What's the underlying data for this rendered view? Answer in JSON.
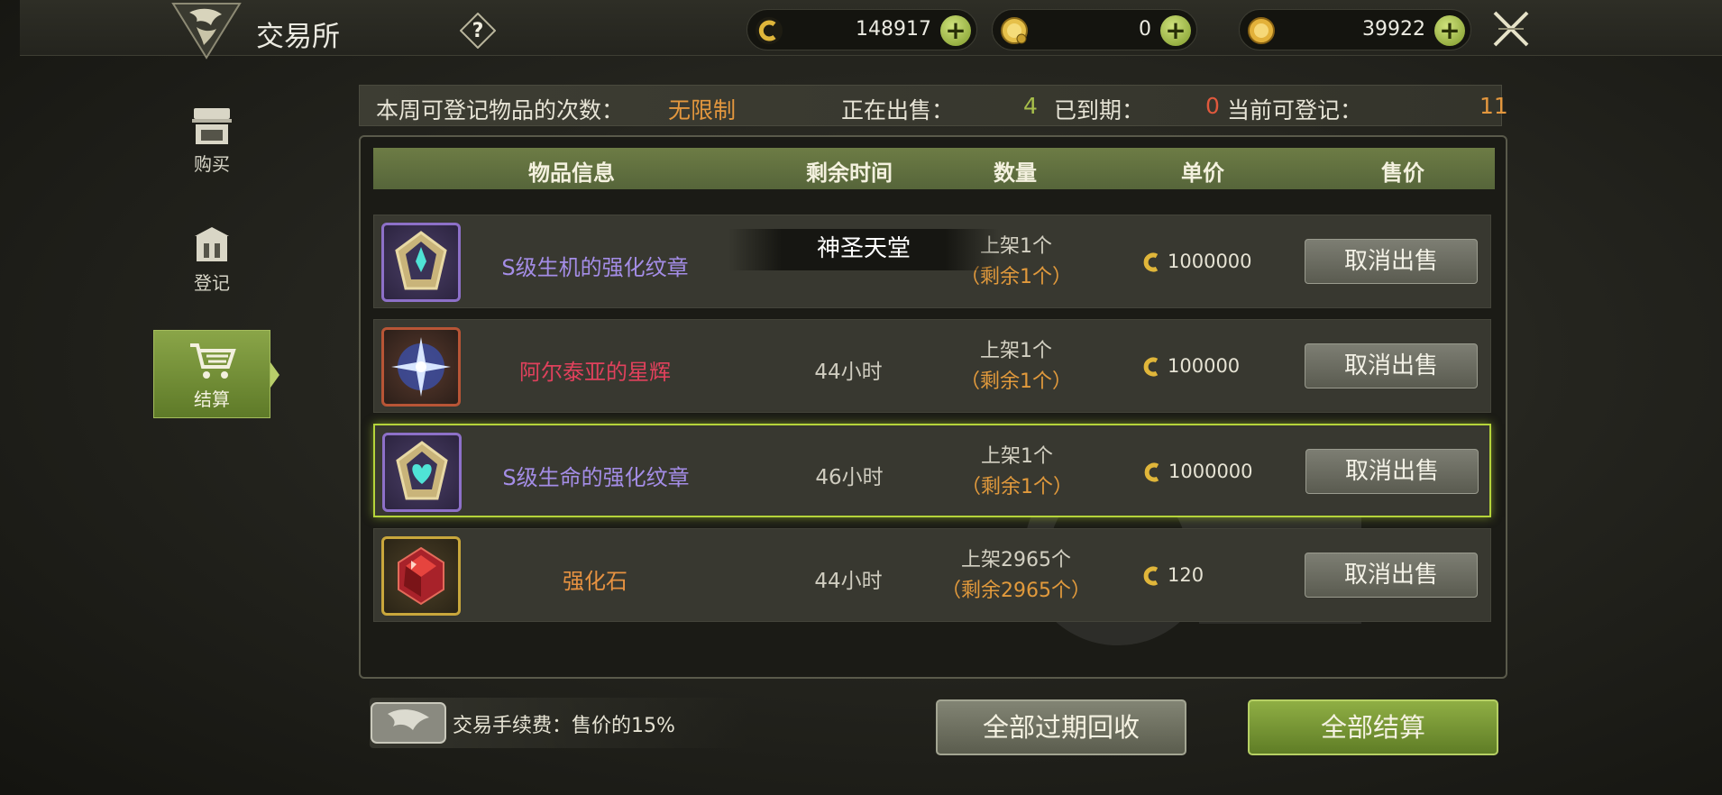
{
  "header": {
    "title": "交易所",
    "help_label": "?",
    "currencies": [
      {
        "name": "silver-coin",
        "amount": "148917",
        "color": "#e0b63a"
      },
      {
        "name": "gem-coin",
        "amount": "0",
        "color": "#e6c04a"
      },
      {
        "name": "gold-coin",
        "amount": "39922",
        "color": "#e3b13a"
      }
    ],
    "plus_label": "+"
  },
  "nav": {
    "items": [
      {
        "label": "购买",
        "icon": "shop-icon",
        "active": false
      },
      {
        "label": "登记",
        "icon": "register-icon",
        "active": false
      },
      {
        "label": "结算",
        "icon": "cart-icon",
        "active": true
      }
    ]
  },
  "stats": {
    "weekly_label": "本周可登记物品的次数：",
    "weekly_value": "无限制",
    "selling_label": "正在出售：",
    "selling_value": "4",
    "expired_label": "已到期：",
    "expired_value": "0",
    "available_label": "当前可登记：",
    "available_value": "11"
  },
  "table": {
    "headers": {
      "info": "物品信息",
      "time": "剩余时间",
      "qty": "数量",
      "unit": "单价",
      "price": "售价"
    },
    "rows": [
      {
        "name": "S级生机的强化纹章",
        "name_color": "purple",
        "time": "",
        "listed": "上架1个",
        "remain": "（剩余1个）",
        "unit_price": "1000000",
        "action": "取消出售",
        "icon": "crest-icon",
        "selected": false
      },
      {
        "name": "阿尔泰亚的星辉",
        "name_color": "red",
        "time": "44小时",
        "listed": "上架1个",
        "remain": "（剩余1个）",
        "unit_price": "100000",
        "action": "取消出售",
        "icon": "star-icon",
        "selected": false
      },
      {
        "name": "S级生命的强化纹章",
        "name_color": "purple",
        "time": "46小时",
        "listed": "上架1个",
        "remain": "（剩余1个）",
        "unit_price": "1000000",
        "action": "取消出售",
        "icon": "heart-crest-icon",
        "selected": true
      },
      {
        "name": "强化石",
        "name_color": "orange",
        "time": "44小时",
        "listed": "上架2965个",
        "remain": "（剩余2965个）",
        "unit_price": "120",
        "action": "取消出售",
        "icon": "gem-icon",
        "selected": false
      }
    ]
  },
  "tooltip": "神圣天堂",
  "footer": {
    "fee_text": "交易手续费：售价的15%",
    "recycle_label": "全部过期回收",
    "settle_label": "全部结算"
  }
}
